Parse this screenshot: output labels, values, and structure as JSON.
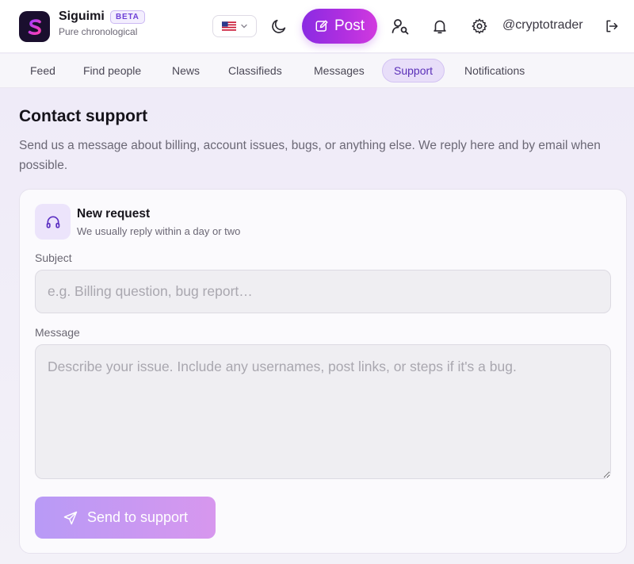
{
  "app": {
    "name": "Siguimi",
    "badge": "BETA",
    "tagline": "Pure chronological"
  },
  "header": {
    "language_flag": "us-flag-icon",
    "post_label": "Post",
    "username": "@cryptotrader",
    "icons": [
      "moon-icon",
      "find-user-icon",
      "bell-icon",
      "gear-icon",
      "logout-icon"
    ]
  },
  "nav": {
    "items": [
      {
        "label": "Feed"
      },
      {
        "label": "Find people"
      },
      {
        "label": "News"
      },
      {
        "label": "Classifieds"
      },
      {
        "label": "Messages"
      },
      {
        "label": "Support",
        "active": true
      },
      {
        "label": "Notifications"
      }
    ]
  },
  "page": {
    "title": "Contact support",
    "description": "Send us a message about billing, account issues, bugs, or anything else. We reply here and by email when possible."
  },
  "form": {
    "title": "New request",
    "subtitle": "We usually reply within a day or two",
    "subject_label": "Subject",
    "subject_placeholder": "e.g. Billing question, bug report…",
    "subject_value": "",
    "message_label": "Message",
    "message_placeholder": "Describe your issue. Include any usernames, post links, or steps if it's a bug.",
    "message_value": "",
    "submit_label": "Send to support"
  },
  "colors": {
    "accent": "#8a2be2",
    "accent_secondary": "#d13adf",
    "active_tab_bg": "#e8def9"
  }
}
